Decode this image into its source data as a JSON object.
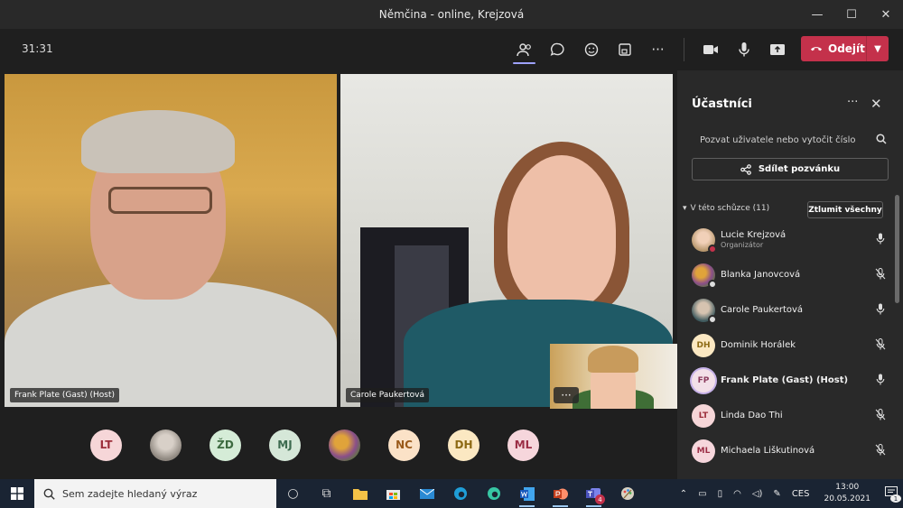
{
  "window": {
    "title": "Němčina - online, Krejzová",
    "minimize": "—",
    "maximize": "☐",
    "close": "✕"
  },
  "toolbar": {
    "timer": "31:31",
    "leave_label": "Odejít"
  },
  "videos": [
    {
      "name": "Frank Plate (Gast) (Host)"
    },
    {
      "name": "Carole Paukertová"
    }
  ],
  "avatar_strip": [
    "LT",
    "",
    "ŽD",
    "MJ",
    "",
    "NC",
    "DH",
    "ML"
  ],
  "selfview": {
    "more": "···"
  },
  "panel": {
    "title": "Účastníci",
    "more": "···",
    "close": "✕",
    "invite_placeholder": "Pozvat uživatele nebo vytočit číslo",
    "share_label": "Sdílet pozvánku",
    "section_label": "V této schůzce (11)",
    "mute_all": "Ztlumit všechny",
    "participants": [
      {
        "initials": "",
        "name": "Lucie Krejzová",
        "role": "Organizátor",
        "status": "busy",
        "mic": "on"
      },
      {
        "initials": "",
        "name": "Blanka Janovcová",
        "role": "",
        "status": "away",
        "mic": "off"
      },
      {
        "initials": "",
        "name": "Carole Paukertová",
        "role": "",
        "status": "away",
        "mic": "on"
      },
      {
        "initials": "DH",
        "name": "Dominik Horálek",
        "role": "",
        "status": "busy",
        "mic": "off"
      },
      {
        "initials": "FP",
        "name": "Frank Plate (Gast) (Host)",
        "role": "",
        "status": "away",
        "mic": "on"
      },
      {
        "initials": "LT",
        "name": "Linda Dao Thi",
        "role": "",
        "status": "busy",
        "mic": "off"
      },
      {
        "initials": "ML",
        "name": "Michaela Liškutinová",
        "role": "",
        "status": "busy",
        "mic": "off"
      }
    ]
  },
  "taskbar": {
    "search_placeholder": "Sem zadejte hledaný výraz",
    "language": "CES",
    "time": "13:00",
    "date": "20.05.2021",
    "teams_badge": "4",
    "notification_count": "1"
  }
}
